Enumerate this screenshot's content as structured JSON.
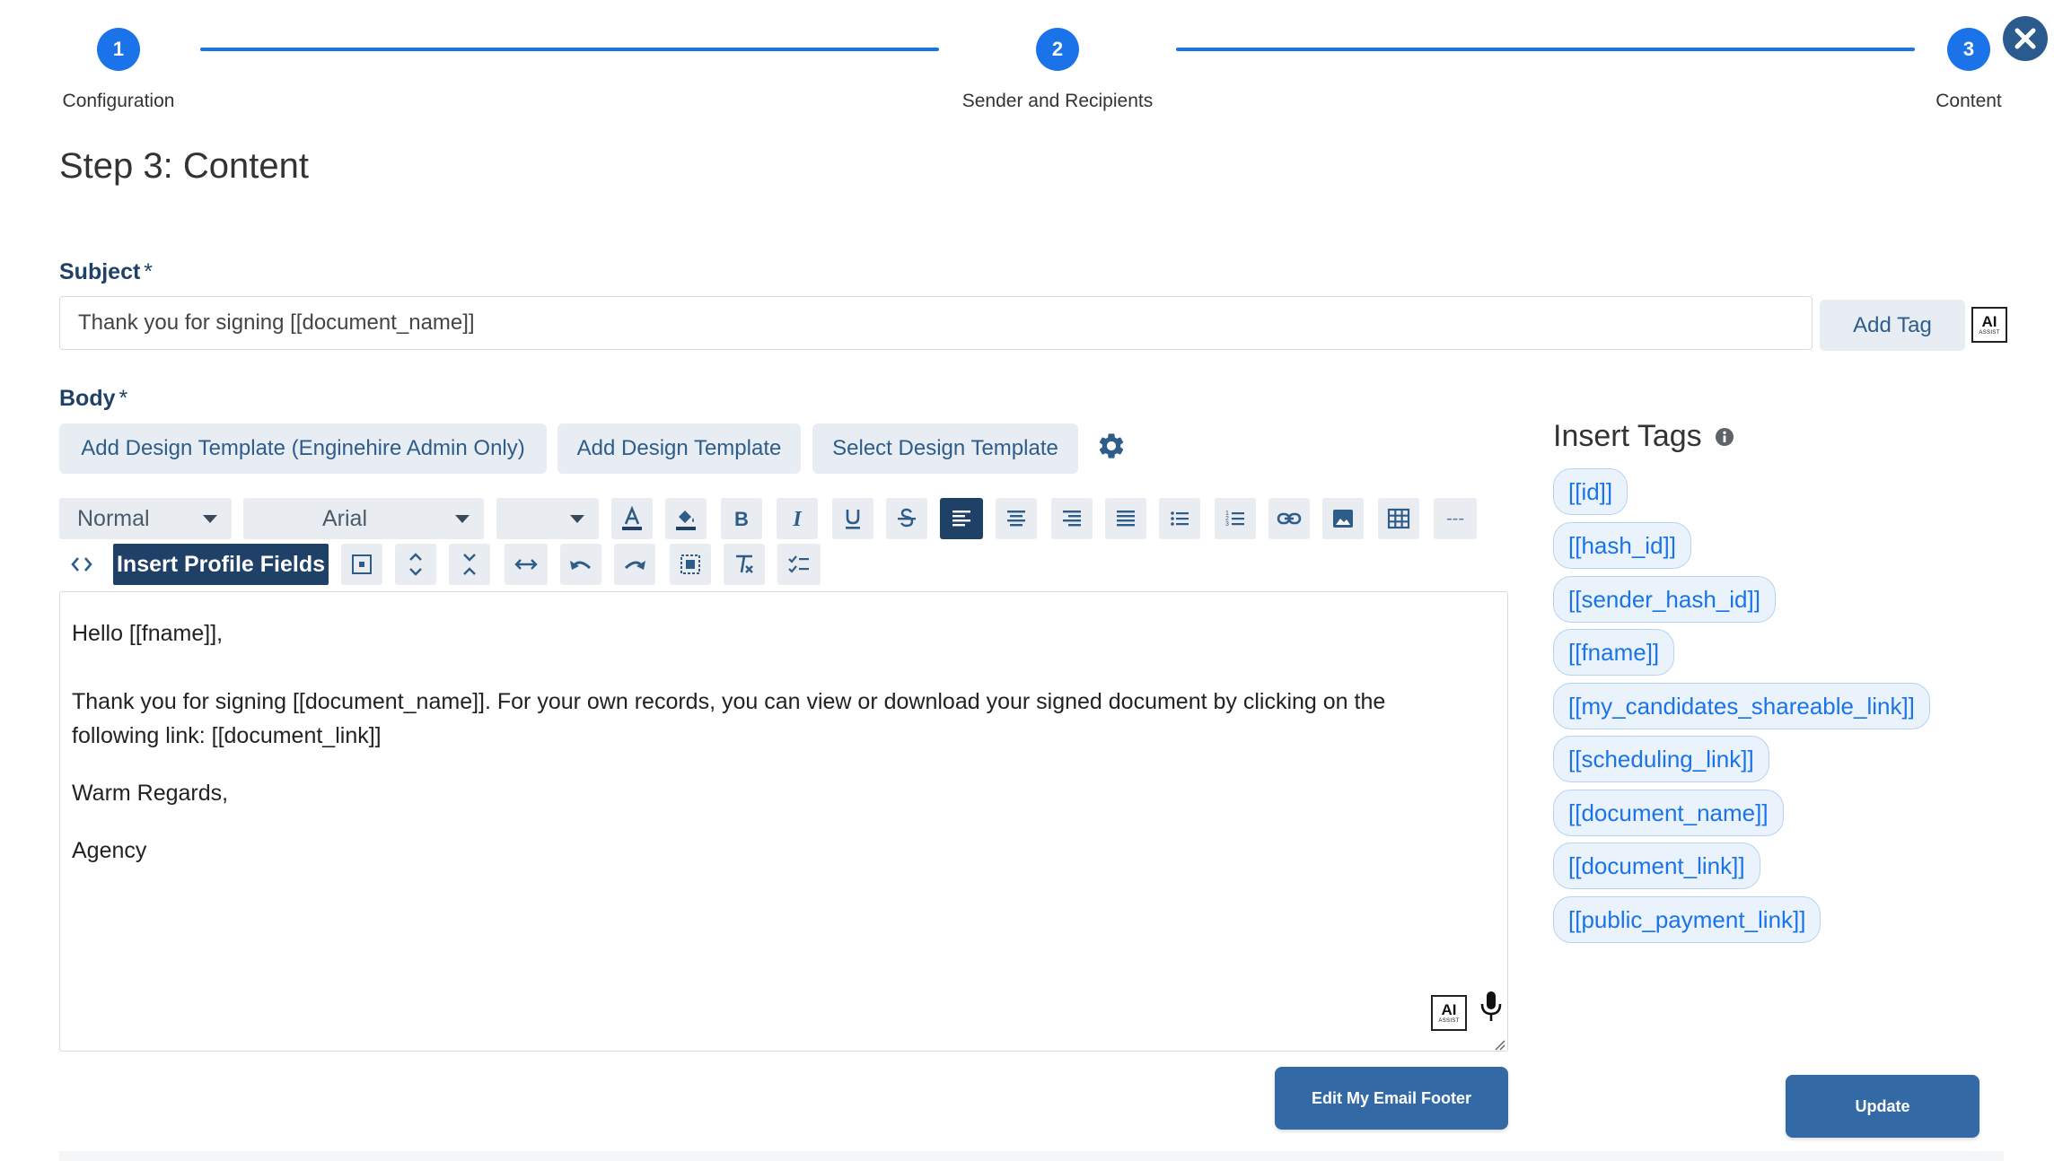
{
  "stepper": {
    "steps": [
      {
        "number": "1",
        "label": "Configuration"
      },
      {
        "number": "2",
        "label": "Sender and Recipients"
      },
      {
        "number": "3",
        "label": "Content"
      }
    ]
  },
  "page_title": "Step 3: Content",
  "subject": {
    "label": "Subject",
    "required_marker": "*",
    "value": "Thank you for signing [[document_name]]",
    "add_tag_label": "Add Tag",
    "ai_label": "AI",
    "ai_sub": "ASSIST"
  },
  "body": {
    "label": "Body",
    "required_marker": "*",
    "template_buttons": [
      "Add Design Template (Enginehire Admin Only)",
      "Add Design Template",
      "Select Design Template"
    ]
  },
  "toolbar": {
    "format_select": "Normal",
    "font_select": "Arial",
    "size_select": "",
    "divider_glyph": "---",
    "insert_profile_fields": "Insert Profile Fields"
  },
  "editor": {
    "lines": [
      "Hello [[fname]],",
      "Thank you for signing [[document_name]]. For your own records, you can view or download your signed document by clicking on the",
      "following link: [[document_link]]",
      "Warm Regards,",
      "Agency"
    ]
  },
  "insert_tags": {
    "title": "Insert Tags",
    "tags": [
      "[[id]]",
      "[[hash_id]]",
      "[[sender_hash_id]]",
      "[[fname]]",
      "[[my_candidates_shareable_link]]",
      "[[scheduling_link]]",
      "[[document_name]]",
      "[[document_link]]",
      "[[public_payment_link]]"
    ]
  },
  "actions": {
    "edit_footer": "Edit My Email Footer",
    "update": "Update"
  },
  "colors": {
    "accent": "#1a73e8",
    "navy": "#1f4167",
    "button_blue": "#3369a4",
    "light_button": "#e7edf3"
  }
}
